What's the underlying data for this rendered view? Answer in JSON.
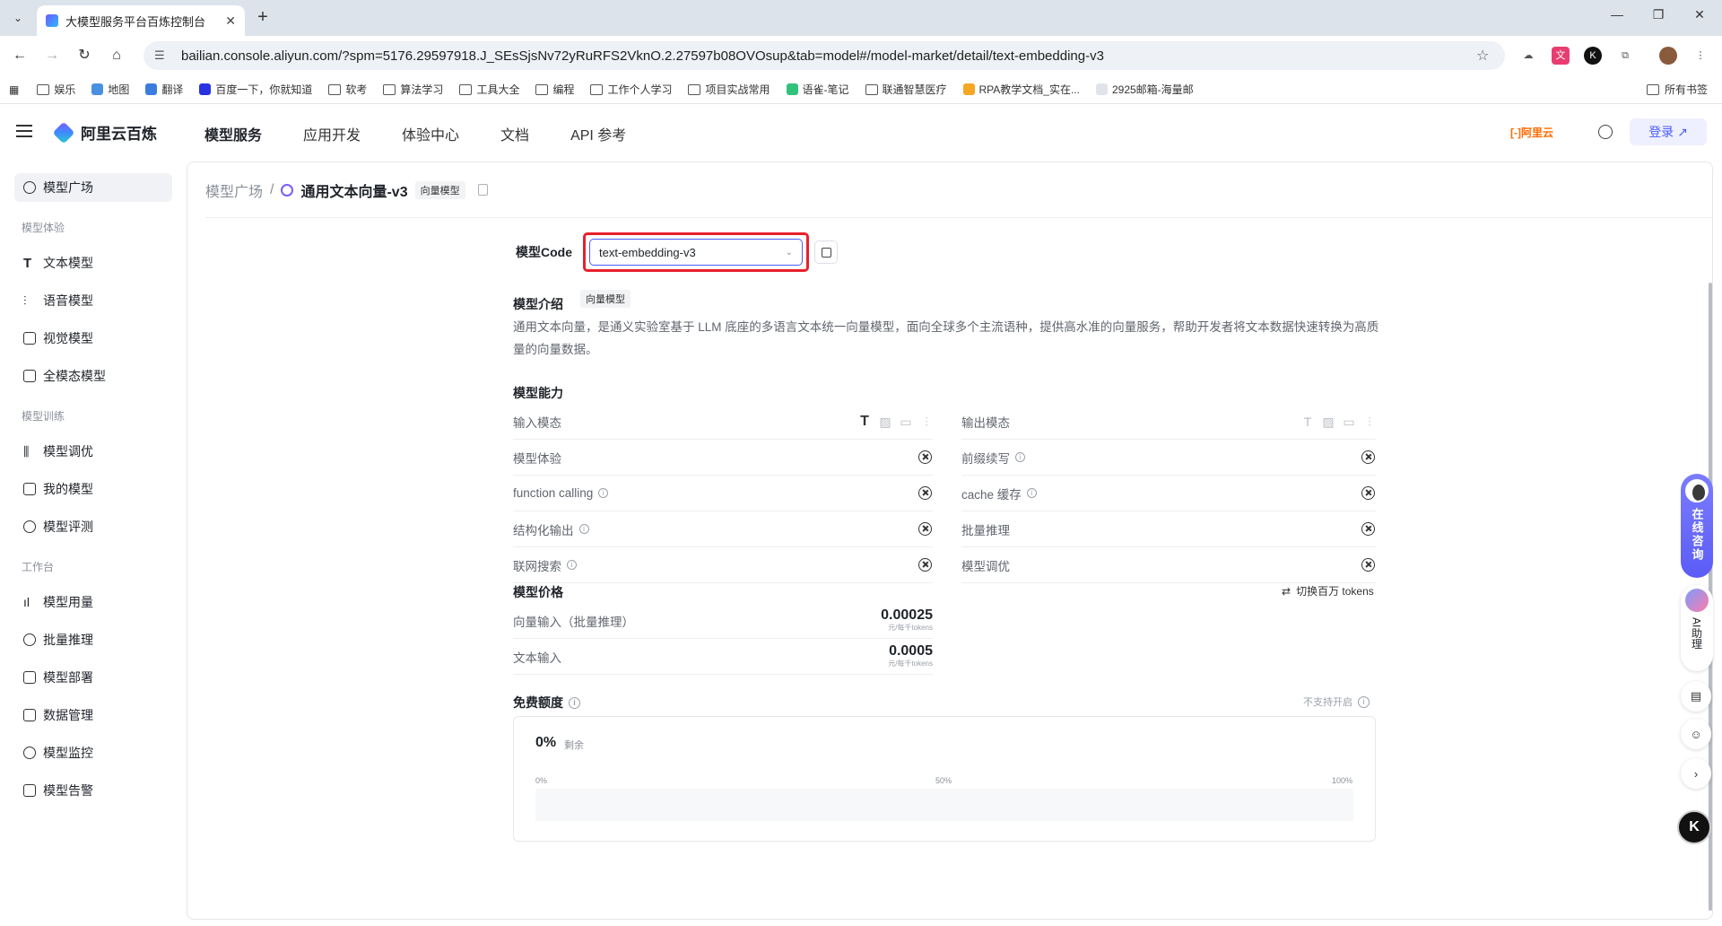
{
  "browser": {
    "tab_title": "大模型服务平台百炼控制台",
    "url": "bailian.console.aliyun.com/?spm=5176.29597918.J_SEsSjsNv72yRuRFS2VknO.2.27597b08OVOsup&tab=model#/model-market/detail/text-embedding-v3",
    "bookmarks": [
      "娱乐",
      "地图",
      "翻译",
      "百度一下，你就知道",
      "软考",
      "算法学习",
      "工具大全",
      "编程",
      "工作个人学习",
      "项目实战常用",
      "语雀-笔记",
      "联通智慧医疗",
      "RPA教学文档_实在...",
      "2925邮箱-海量邮"
    ],
    "all_bookmarks": "所有书签"
  },
  "header": {
    "logo_text": "阿里云百炼",
    "nav": [
      "模型服务",
      "应用开发",
      "体验中心",
      "文档",
      "API 参考"
    ],
    "brand": "[-]阿里云",
    "login": "登录 ↗"
  },
  "sidebar": {
    "top_item": "模型广场",
    "groups": [
      {
        "title": "模型体验",
        "items": [
          "文本模型",
          "语音模型",
          "视觉模型",
          "全模态模型"
        ]
      },
      {
        "title": "模型训练",
        "items": [
          "模型调优",
          "我的模型",
          "模型评测"
        ]
      },
      {
        "title": "工作台",
        "items": [
          "模型用量",
          "批量推理",
          "模型部署",
          "数据管理",
          "模型监控",
          "模型告警"
        ]
      }
    ]
  },
  "breadcrumb": {
    "root": "模型广场",
    "sep": "/",
    "current": "通用文本向量-v3",
    "tag": "向量模型"
  },
  "model_code": {
    "label": "模型Code",
    "value": "text-embedding-v3"
  },
  "intro": {
    "title": "模型介绍",
    "tag": "向量模型",
    "text": "通用文本向量，是通义实验室基于 LLM 底座的多语言文本统一向量模型，面向全球多个主流语种，提供高水准的向量服务，帮助开发者将文本数据快速转换为高质量的向量数据。"
  },
  "capabilities": {
    "title": "模型能力",
    "left": [
      {
        "label": "输入模态",
        "type": "modal"
      },
      {
        "label": "模型体验",
        "info": false
      },
      {
        "label": "function calling",
        "info": true
      },
      {
        "label": "结构化输出",
        "info": true
      },
      {
        "label": "联网搜索",
        "info": true
      }
    ],
    "right": [
      {
        "label": "输出模态",
        "type": "modal"
      },
      {
        "label": "前缀续写",
        "info": true
      },
      {
        "label": "cache 缓存",
        "info": true
      },
      {
        "label": "批量推理",
        "info": false
      },
      {
        "label": "模型调优",
        "info": false
      }
    ]
  },
  "pricing": {
    "title": "模型价格",
    "switch_label": "切换百万 tokens",
    "rows": [
      {
        "label": "向量输入（批量推理）",
        "value": "0.00025",
        "unit": "元/每千tokens"
      },
      {
        "label": "文本输入",
        "value": "0.0005",
        "unit": "元/每千tokens"
      }
    ]
  },
  "free_quota": {
    "title": "免费额度",
    "hint": "不支持开启",
    "percent": "0%",
    "remaining_label": "剩余",
    "ticks": [
      "0%",
      "50%",
      "100%"
    ]
  },
  "float": {
    "consult": "在线咨询",
    "ai_helper": "AI助理",
    "k": "K"
  }
}
